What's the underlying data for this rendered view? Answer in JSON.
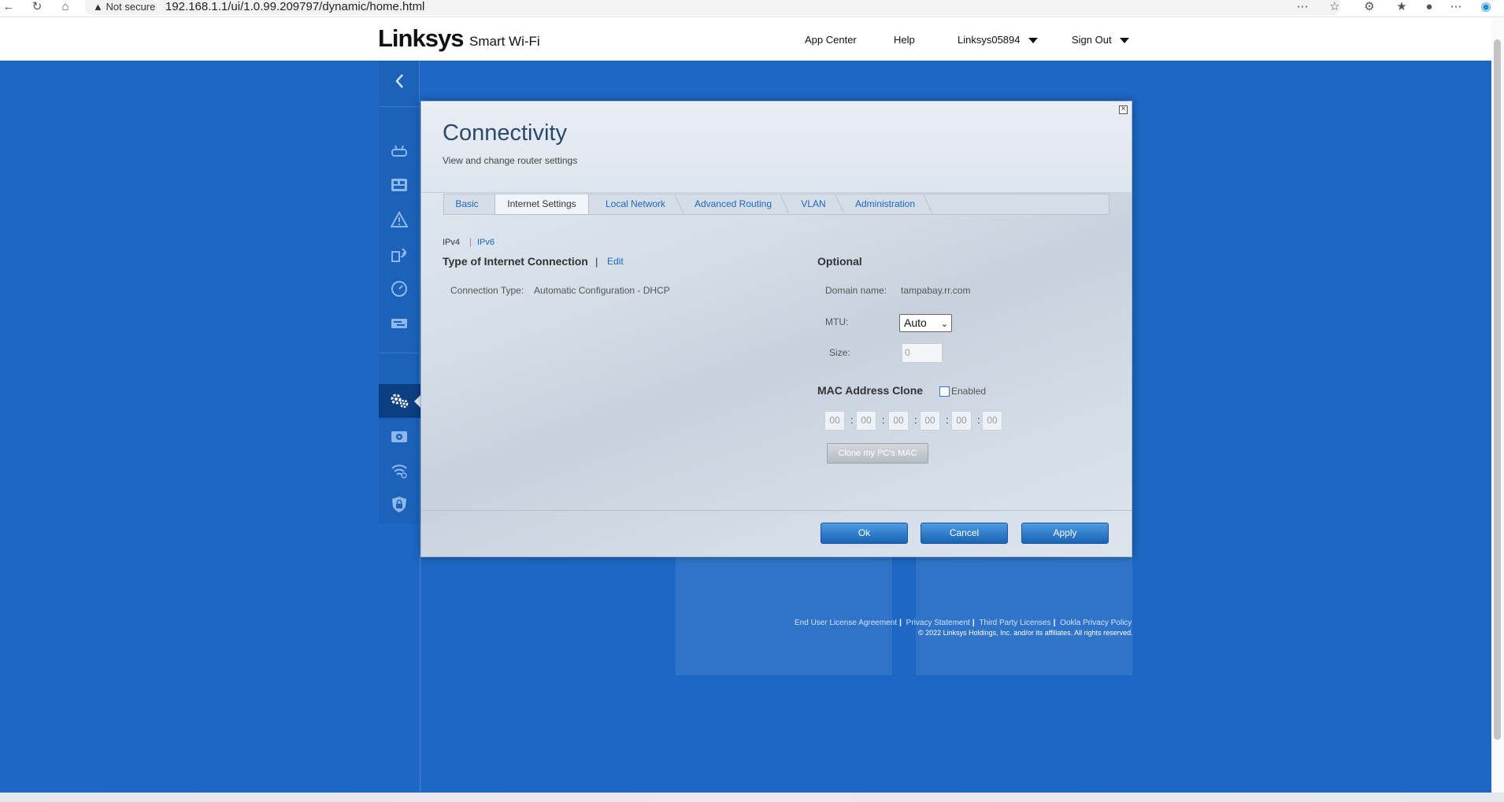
{
  "browser": {
    "security_label": "Not secure",
    "url": "192.168.1.1/ui/1.0.99.209797/dynamic/home.html"
  },
  "header": {
    "logo": "Linksys",
    "product": "Smart Wi-Fi",
    "nav": {
      "app_center": "App Center",
      "help": "Help",
      "account": "Linksys05894",
      "sign_out": "Sign Out"
    }
  },
  "sidebar": {
    "icons": [
      "router-icon",
      "device-list-icon",
      "troubleshoot-icon",
      "smart-connect-icon",
      "speed-test-icon",
      "media-prioritization-icon",
      "connectivity-icon",
      "external-storage-icon",
      "wireless-icon",
      "security-icon"
    ],
    "selected": "connectivity-icon"
  },
  "footer": {
    "links": [
      "End User License Agreement",
      "Privacy Statement",
      "Third Party Licenses",
      "Ookla Privacy Policy"
    ],
    "copyright": "© 2022 Linksys Holdings, Inc. and/or its affiliates. All rights reserved."
  },
  "modal": {
    "title": "Connectivity",
    "subtitle": "View and change router settings",
    "close": "⊠",
    "tabs": [
      "Basic",
      "Internet Settings",
      "Local Network",
      "Advanced Routing",
      "VLAN",
      "Administration"
    ],
    "active_tab": "Internet Settings",
    "ip_versions": {
      "ipv4": "IPv4",
      "separator": "|",
      "ipv6": "IPv6"
    },
    "connection": {
      "heading": "Type of Internet Connection",
      "separator": "|",
      "edit_label": "Edit",
      "type_label": "Connection Type:",
      "type_value": "Automatic Configuration - DHCP"
    },
    "optional": {
      "heading": "Optional",
      "domain_label": "Domain name:",
      "domain_value": "tampabay.rr.com",
      "mtu_label": "MTU:",
      "mtu_value": "Auto",
      "size_label": "Size:",
      "size_value": "0"
    },
    "mac_clone": {
      "heading": "MAC Address Clone",
      "enabled_label": "Enabled",
      "enabled": false,
      "octets": [
        "00",
        "00",
        "00",
        "00",
        "00",
        "00"
      ],
      "clone_button": "Clone my PC's MAC"
    },
    "buttons": {
      "ok": "Ok",
      "cancel": "Cancel",
      "apply": "Apply"
    }
  },
  "colors": {
    "background": "#1e67c4",
    "link": "#1a67c2",
    "button": "#2a78cc"
  }
}
